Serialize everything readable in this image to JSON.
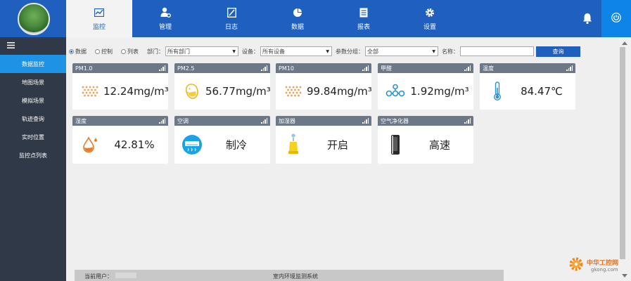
{
  "nav": {
    "items": [
      {
        "label": "监控",
        "icon": "chart-line-icon",
        "active": true
      },
      {
        "label": "管理",
        "icon": "user-settings-icon"
      },
      {
        "label": "日志",
        "icon": "log-icon"
      },
      {
        "label": "数据",
        "icon": "pie-chart-icon"
      },
      {
        "label": "报表",
        "icon": "report-icon"
      },
      {
        "label": "设置",
        "icon": "gear-icon"
      }
    ]
  },
  "sidebar": {
    "items": [
      {
        "label": "数据监控",
        "active": true
      },
      {
        "label": "地图场景"
      },
      {
        "label": "模拟场景"
      },
      {
        "label": "轨迹查询"
      },
      {
        "label": "实时位置"
      },
      {
        "label": "监控点列表"
      }
    ]
  },
  "filter": {
    "radios": [
      {
        "label": "数据",
        "selected": true
      },
      {
        "label": "控制",
        "selected": false
      },
      {
        "label": "列表",
        "selected": false
      }
    ],
    "dept_label": "部门：",
    "dept_value": "所有部门",
    "device_label": "设备：",
    "device_value": "所有设备",
    "group_label": "参数分组：",
    "group_value": "全部",
    "name_label": "名称：",
    "name_value": "",
    "query_label": "查询"
  },
  "cards": [
    {
      "title": "PM1.0",
      "value": "12.24mg/m³",
      "icon": "particle-grid-icon"
    },
    {
      "title": "PM2.5",
      "value": "56.77mg/m³",
      "icon": "mask-face-icon"
    },
    {
      "title": "PM10",
      "value": "99.84mg/m³",
      "icon": "particle-grid-icon"
    },
    {
      "title": "甲醛",
      "value": "1.92mg/m³",
      "icon": "molecule-icon"
    },
    {
      "title": "温度",
      "value": "84.47℃",
      "icon": "thermometer-icon"
    },
    {
      "title": "湿度",
      "value": "42.81%",
      "icon": "water-drop-icon"
    },
    {
      "title": "空调",
      "value": "制冷",
      "icon": "air-conditioner-icon"
    },
    {
      "title": "加湿器",
      "value": "开启",
      "icon": "humidifier-icon"
    },
    {
      "title": "空气净化器",
      "value": "高速",
      "icon": "air-purifier-icon"
    }
  ],
  "footer": {
    "user_label": "当前用户：",
    "system_name": "室内环境监测系统"
  },
  "watermark": {
    "title": "中华工控网",
    "url": "gkong.com"
  },
  "colors": {
    "topbar": "#1f5fbe",
    "sidebar": "#2f3947",
    "sidebar_active": "#1e93e6",
    "card_header": "#6c7788",
    "icon_accent": "#e8a45a"
  }
}
